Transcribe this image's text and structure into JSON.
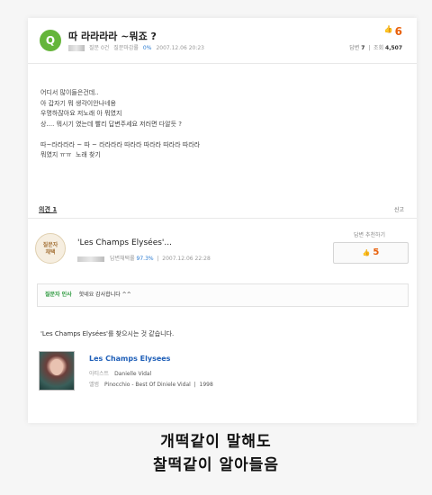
{
  "question": {
    "badge": "Q",
    "title": "따 라라라라 ~뭐죠 ?",
    "meta": {
      "grade": "질문 0건",
      "closing_rate_label": "질문마감률",
      "closing_rate": "0%",
      "datetime": "2007.12.06 20:23"
    },
    "recommend_count": "6",
    "answers_label": "답변",
    "answers_count": "7",
    "views_label": "조회",
    "views_count": "4,507",
    "body": [
      "어디서 많이들은건데..",
      "아 갑자기 뭐 생각이안나네용",
      "우명하잖아요 저노래 아 뭐였지",
      "상.... 뭐시기 였는데 빨리 답변주세요 저러면 다알듯 ?",
      "",
      "따~라라라라 ~ 따 ~ 라라라라 따라라 따라라 따라라 따라라",
      "뭐였지 ㅠㅠ  노래 찾기"
    ],
    "opinion_label": "의견 1",
    "report_label": "신고"
  },
  "answer": {
    "asker_badge_line1": "질문자",
    "asker_badge_line2": "채택",
    "title": "'Les Champs Elysées'...",
    "meta": {
      "rate_label": "답변채택률",
      "rate": "97.3%",
      "datetime": "2007.12.06 22:28"
    },
    "recommend_label": "답변 추천하기",
    "recommend_count": "5",
    "thanks_label": "질문자 인사",
    "thanks_text": "핫네요 감사합니다 ^^",
    "text": "'Les Champs Elysées'를 찾으시는 것 같습니다.",
    "song": {
      "title": "Les Champs Elysees",
      "artist_label": "아티스트",
      "artist": "Danielle Vidal",
      "album_label": "앨범",
      "album": "Pinocchio - Best Of Diniele Vidal",
      "year": "1998"
    }
  },
  "caption": {
    "line1": "개떡같이 말해도",
    "line2": "찰떡같이 알아들음"
  },
  "colors": {
    "q_badge": "#65b53a",
    "recommend": "#e8600b",
    "link": "#1f5fb8",
    "thanks_label": "#2e9a3f"
  }
}
